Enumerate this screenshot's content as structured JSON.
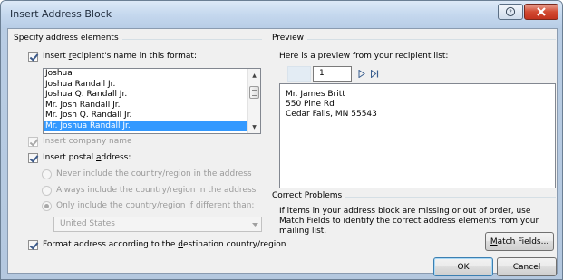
{
  "window": {
    "title": "Insert Address Block"
  },
  "specify": {
    "group_title": "Specify address elements",
    "recipient_name": {
      "label_pre": "Insert ",
      "label_acc": "r",
      "label_post": "ecipient's name in this format:",
      "checked": true
    },
    "name_formats": [
      "Joshua",
      "Joshua Randall Jr.",
      "Joshua Q. Randall Jr.",
      "Mr. Josh Randall Jr.",
      "Mr. Josh Q. Randall Jr.",
      "Mr. Joshua Randall Jr."
    ],
    "selected_index": 5,
    "company_name": {
      "label": "Insert company name",
      "checked": true,
      "disabled": true
    },
    "postal_address": {
      "label_pre": "Insert postal ",
      "label_acc": "a",
      "label_post": "ddress:",
      "checked": true
    },
    "country_options": [
      "Never include the country/region in the address",
      "Always include the country/region in the address",
      "Only include the country/region if different than:"
    ],
    "country_selected_index": 2,
    "country_value": "United States",
    "format_address": {
      "label_pre": "Format address according to the ",
      "label_acc": "d",
      "label_post": "estination country/region",
      "checked": true
    }
  },
  "preview": {
    "group_title": "Preview",
    "hint": "Here is a preview from your recipient list:",
    "record_number": "1",
    "address_lines": [
      "Mr. James Britt",
      "550 Pine Rd",
      "Cedar Falls, MN 55543"
    ]
  },
  "correct": {
    "group_title": "Correct Problems",
    "description": "If items in your address block are missing or out of order, use Match Fields to identify the correct address elements from your mailing list.",
    "match_fields": {
      "acc": "M",
      "post": "atch Fields..."
    }
  },
  "buttons": {
    "ok": "OK",
    "cancel": "Cancel"
  },
  "icons": {
    "help": "help-icon",
    "close": "close-icon",
    "next": "next-record-icon",
    "last": "last-record-icon"
  },
  "colors": {
    "selection": "#3399ff",
    "close_button": "#c2331e"
  }
}
